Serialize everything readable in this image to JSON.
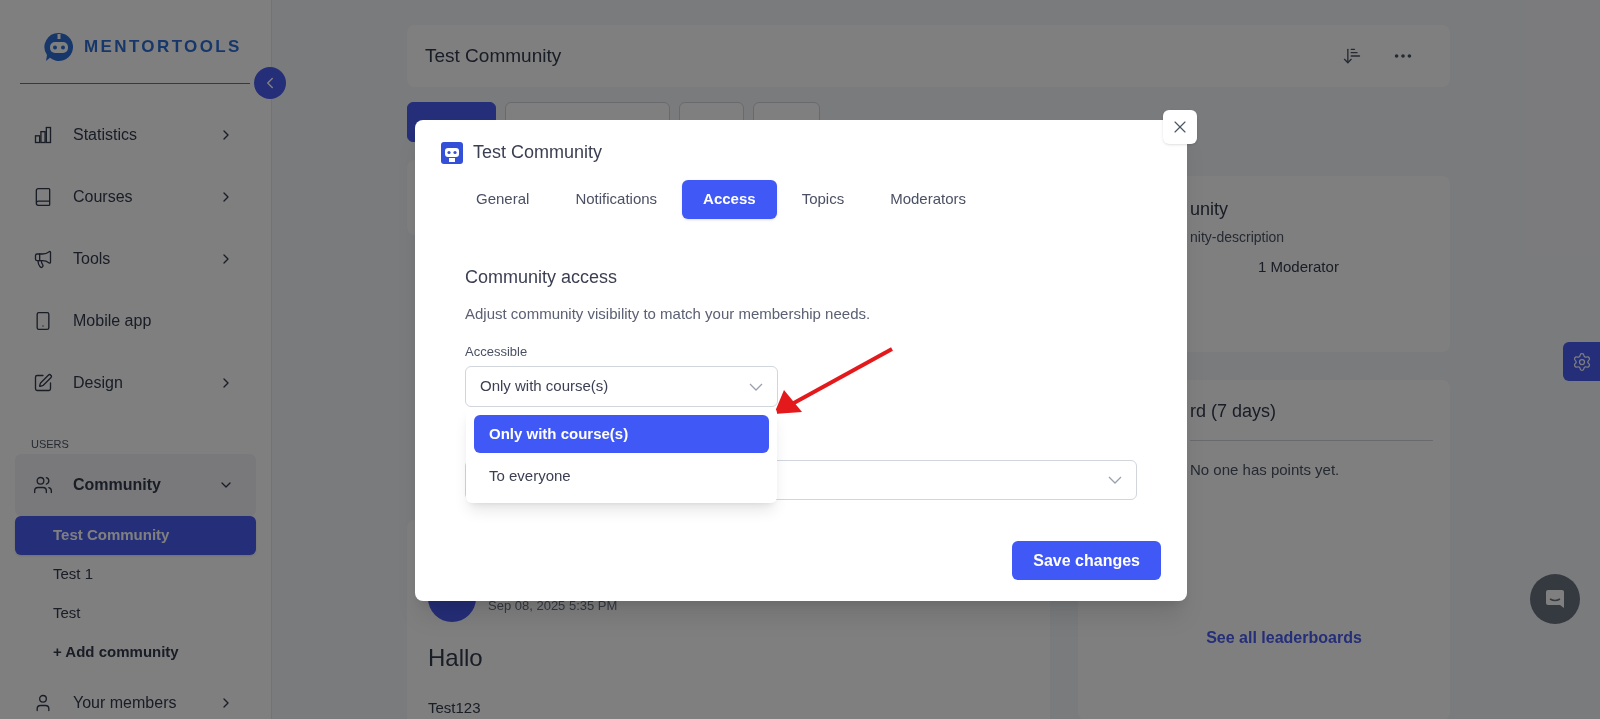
{
  "sidebar": {
    "logo_text": "MENTORTOOLS",
    "items": [
      {
        "kind": "group",
        "label": "Statistics",
        "expanded": false
      },
      {
        "kind": "group",
        "label": "Courses",
        "expanded": false
      },
      {
        "kind": "group",
        "label": "Tools",
        "expanded": false
      },
      {
        "kind": "link",
        "label": "Mobile app"
      },
      {
        "kind": "group",
        "label": "Design",
        "expanded": false
      },
      {
        "kind": "heading",
        "label": "USERS"
      },
      {
        "kind": "group",
        "label": "Community",
        "expanded": true
      },
      {
        "kind": "sub",
        "label": "Test Community",
        "selected": true
      },
      {
        "kind": "sub",
        "label": "Test 1",
        "selected": false
      },
      {
        "kind": "sub",
        "label": "Test",
        "selected": false
      },
      {
        "kind": "add",
        "label": "+ Add community"
      },
      {
        "kind": "group",
        "label": "Your members",
        "expanded": false
      }
    ]
  },
  "header": {
    "title": "Test Community"
  },
  "topic_tabs": [
    {
      "selected": true
    },
    {
      "selected": false
    },
    {
      "selected": false
    },
    {
      "selected": false
    }
  ],
  "community_card": {
    "name": "unity",
    "description": "nity-description",
    "moderators": "1 Moderator"
  },
  "leaderboard": {
    "title": "rd (7 days)",
    "empty": "No one has points yet.",
    "link": "See all leaderboards"
  },
  "post": {
    "date": "Sep 08, 2025 5:35 PM",
    "title": "Hallo",
    "body": "Test123"
  },
  "modal": {
    "title": "Test Community",
    "tabs": [
      {
        "label": "General",
        "selected": false
      },
      {
        "label": "Notifications",
        "selected": false
      },
      {
        "label": "Access",
        "selected": true
      },
      {
        "label": "Topics",
        "selected": false
      },
      {
        "label": "Moderators",
        "selected": false
      }
    ],
    "section_title": "Community access",
    "description": "Adjust community visibility to match your membership needs.",
    "field_label": "Accessible",
    "select": {
      "value": "Only with course(s)",
      "open": true,
      "options": [
        {
          "label": "Only with course(s)",
          "selected": true
        },
        {
          "label": "To everyone",
          "selected": false
        }
      ]
    },
    "save_button": "Save changes"
  }
}
